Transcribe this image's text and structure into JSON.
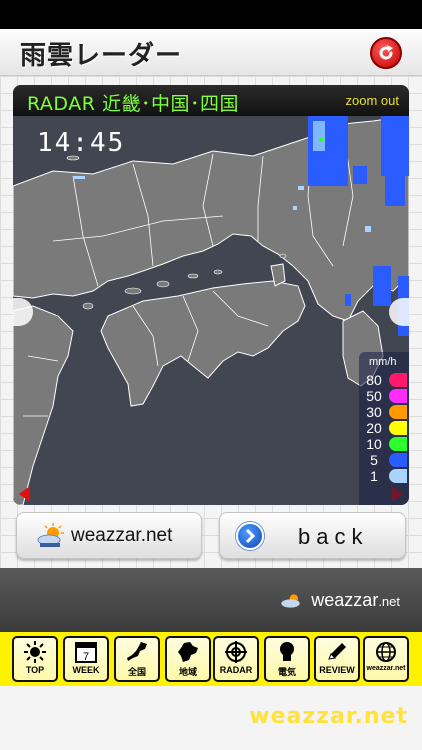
{
  "header": {
    "title": "雨雲レーダー",
    "refresh_icon": "refresh-icon"
  },
  "radar": {
    "title": "RADAR 近畿･中国･四国",
    "zoom_label": "zoom out",
    "time": "14:45",
    "legend": {
      "unit": "mm/h",
      "levels": [
        {
          "label": "80",
          "color": "#ff1a6e"
        },
        {
          "label": "50",
          "color": "#ff2bff"
        },
        {
          "label": "30",
          "color": "#ff9a00"
        },
        {
          "label": "20",
          "color": "#ffff00"
        },
        {
          "label": "10",
          "color": "#2cff2c"
        },
        {
          "label": "5",
          "color": "#2b5cff"
        },
        {
          "label": "1",
          "color": "#a9d4ff"
        }
      ]
    }
  },
  "buttons": {
    "weazzar_label": "weazzar.net",
    "back_label": "back"
  },
  "footer": {
    "brand": "weazzar",
    "brand_suffix": ".net"
  },
  "tabs": [
    {
      "label": "TOP",
      "icon": "sun-icon"
    },
    {
      "label": "WEEK",
      "icon": "calendar-icon",
      "day": "7"
    },
    {
      "label": "全国",
      "icon": "japan-map-icon"
    },
    {
      "label": "地域",
      "icon": "region-map-icon"
    },
    {
      "label": "RADAR",
      "icon": "radar-icon"
    },
    {
      "label": "電気",
      "icon": "lightbulb-icon"
    },
    {
      "label": "REVIEW",
      "icon": "pencil-icon"
    },
    {
      "label": "weazzar.net",
      "icon": "globe-icon"
    }
  ],
  "bottom_brand": "weazzar.net"
}
